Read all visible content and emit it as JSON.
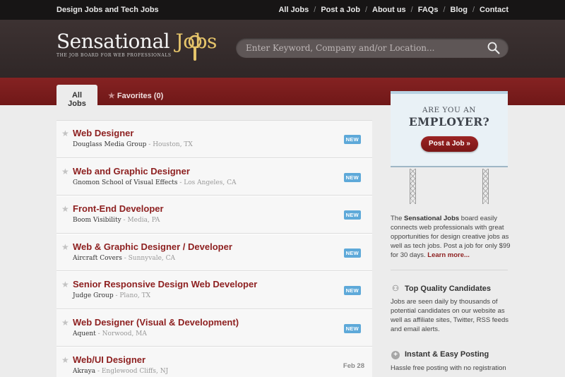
{
  "topbar": {
    "brand": "Design Jobs and Tech Jobs",
    "nav": [
      "All Jobs",
      "Post a Job",
      "About us",
      "FAQs",
      "Blog",
      "Contact"
    ]
  },
  "header": {
    "logo_word": "Sensational",
    "logo_jobs": "Jobs",
    "tagline": "THE JOB BOARD FOR WEB PROFESSIONALS",
    "search_placeholder": "Enter Keyword, Company and/or Location..."
  },
  "tabs": {
    "all": "All Jobs",
    "favorites": "Favorites (0)"
  },
  "jobs": [
    {
      "title": "Web Designer",
      "company": "Douglass Media Group",
      "location": "Houston, TX",
      "badge": "NEW"
    },
    {
      "title": "Web and Graphic Designer",
      "company": "Gnomon School of Visual Effects",
      "location": "Los Angeles, CA",
      "badge": "NEW"
    },
    {
      "title": "Front-End Developer",
      "company": "Boom Visibility",
      "location": "Media, PA",
      "badge": "NEW"
    },
    {
      "title": "Web & Graphic Designer / Developer",
      "company": "Aircraft Covers",
      "location": "Sunnyvale, CA",
      "badge": "NEW"
    },
    {
      "title": "Senior Responsive Design Web Developer",
      "company": "Judge Group",
      "location": "Plano, TX",
      "badge": "NEW"
    },
    {
      "title": "Web Designer (Visual & Development)",
      "company": "Aquent",
      "location": "Norwood, MA",
      "badge": "NEW"
    },
    {
      "title": "Web/UI Designer",
      "company": "Akraya",
      "location": "Englewood Cliffs, NJ",
      "date": "Feb 28"
    }
  ],
  "sidebar": {
    "bb_top": "ARE YOU AN",
    "bb_main": "EMPLOYER?",
    "post_button": "Post a Job »",
    "intro_pre": "The ",
    "intro_bold": "Sensational Jobs",
    "intro_post": " board easily connects web professionals with great opportunities for design creative jobs as well as tech jobs. Post a job for only $99 for 30 days. ",
    "learn_more": "Learn more...",
    "feature1_title": "Top Quality Candidates",
    "feature1_text": "Jobs are seen daily by thousands of potential candidates on our website as well as affiliate sites, Twitter, RSS feeds and email alerts.",
    "feature2_title": "Instant & Easy Posting",
    "feature2_text": "Hassle free posting with no registration"
  },
  "colors": {
    "accent_red": "#8d1f1f",
    "badge_blue": "#5ea9d9",
    "header_dark": "#3a3030",
    "band_red": "#7c1d1d"
  }
}
